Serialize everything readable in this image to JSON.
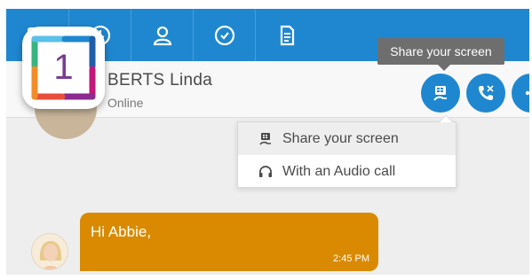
{
  "nav": {
    "tabs": [
      {
        "name": "chat-tab",
        "icon": "chat-icon"
      },
      {
        "name": "history-tab",
        "icon": "clock-icon"
      },
      {
        "name": "contacts-tab",
        "icon": "user-icon"
      },
      {
        "name": "presence-tab",
        "icon": "check-circle-icon"
      },
      {
        "name": "files-tab",
        "icon": "document-icon"
      }
    ]
  },
  "contact": {
    "name": "BERTS Linda",
    "status": "Online"
  },
  "tooltip": {
    "text": "Share your screen"
  },
  "actions": {
    "share_icon": "screen-share-icon",
    "call_icon": "phone-icon",
    "more_icon": "more-icon"
  },
  "menu": {
    "items": [
      {
        "label": "Share your screen",
        "icon": "screen-share-icon"
      },
      {
        "label": "With an Audio call",
        "icon": "headphones-icon"
      }
    ]
  },
  "message": {
    "text": "Hi Abbie,",
    "time": "2:45 PM"
  },
  "badge": {
    "number": "1"
  },
  "colors": {
    "brand_blue": "#1f87d0",
    "bubble_orange": "#d98a00",
    "tooltip_gray": "#6e6e6e"
  }
}
